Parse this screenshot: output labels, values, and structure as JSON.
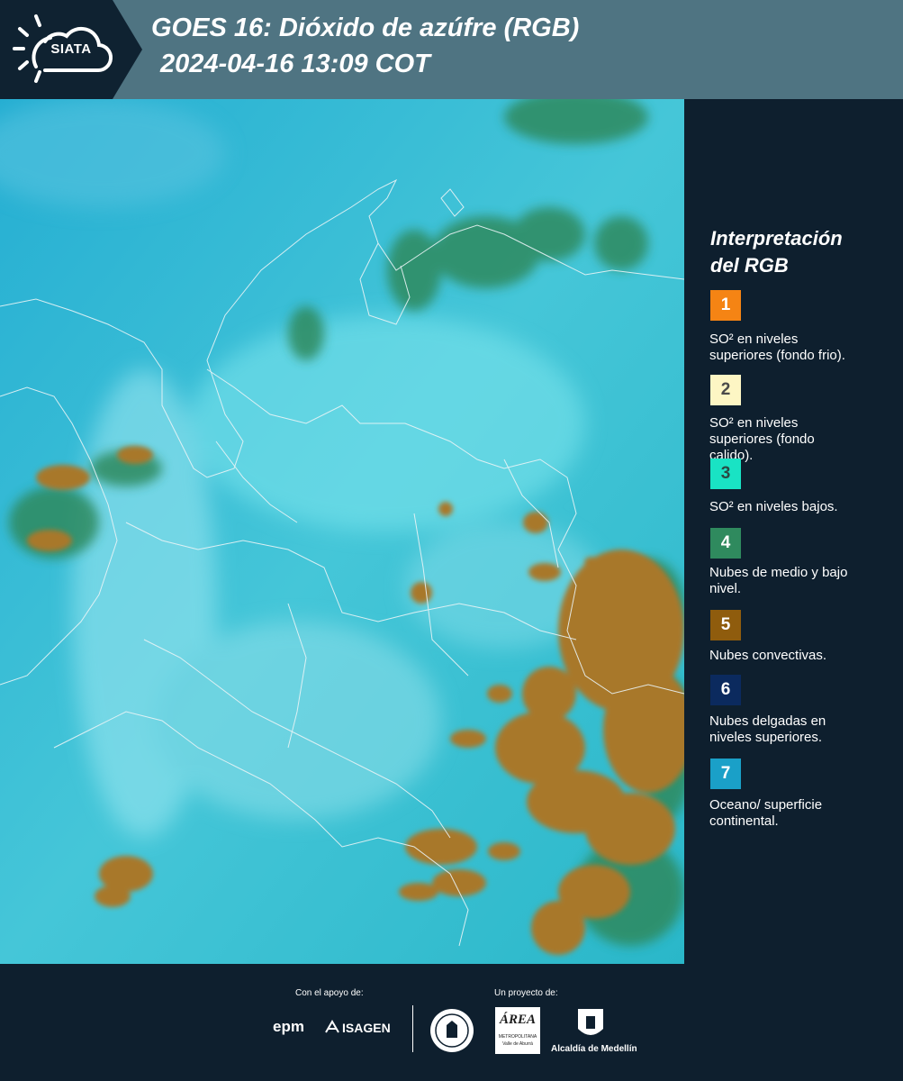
{
  "header": {
    "logo_text": "SIATA",
    "title_line1": "GOES 16: Dióxido de azúfre (RGB)",
    "title_line2": "2024-04-16 13:09 COT"
  },
  "legend": {
    "title_line1": "Interpretación",
    "title_line2": "del RGB",
    "items": [
      {
        "number": "1",
        "color": "#f58414",
        "text_color": "#ffffff",
        "label_lines": [
          "SO² en niveles",
          "superiores (fondo frio)."
        ]
      },
      {
        "number": "2",
        "color": "#fdf6c4",
        "text_color": "#4a4a4a",
        "label_lines": [
          "SO² en niveles",
          "superiores (fondo",
          "calido)."
        ]
      },
      {
        "number": "3",
        "color": "#19e3c4",
        "text_color": "#2a4a44",
        "label_lines": [
          "SO² en niveles bajos."
        ]
      },
      {
        "number": "4",
        "color": "#2f8a5e",
        "text_color": "#ffffff",
        "label_lines": [
          "Nubes de medio y bajo",
          "nivel."
        ]
      },
      {
        "number": "5",
        "color": "#8f5c0d",
        "text_color": "#ffffff",
        "label_lines": [
          "Nubes convectivas."
        ]
      },
      {
        "number": "6",
        "color": "#0b2a5e",
        "text_color": "#ffffff",
        "label_lines": [
          "Nubes delgadas en",
          "niveles superiores."
        ]
      },
      {
        "number": "7",
        "color": "#1aa0c8",
        "text_color": "#ffffff",
        "label_lines": [
          "Oceano/ superficie",
          "continental."
        ]
      }
    ]
  },
  "footer": {
    "support_caption": "Con el apoyo de:",
    "project_caption": "Un proyecto de:",
    "sponsor1": "epm",
    "sponsor2": "ISAGEN",
    "partner1_line1": "ÁREA",
    "partner1_line2": "METROPOLITANA",
    "partner1_line3": "Valle de Aburrá",
    "partner2": "Alcaldía de Medellín"
  }
}
